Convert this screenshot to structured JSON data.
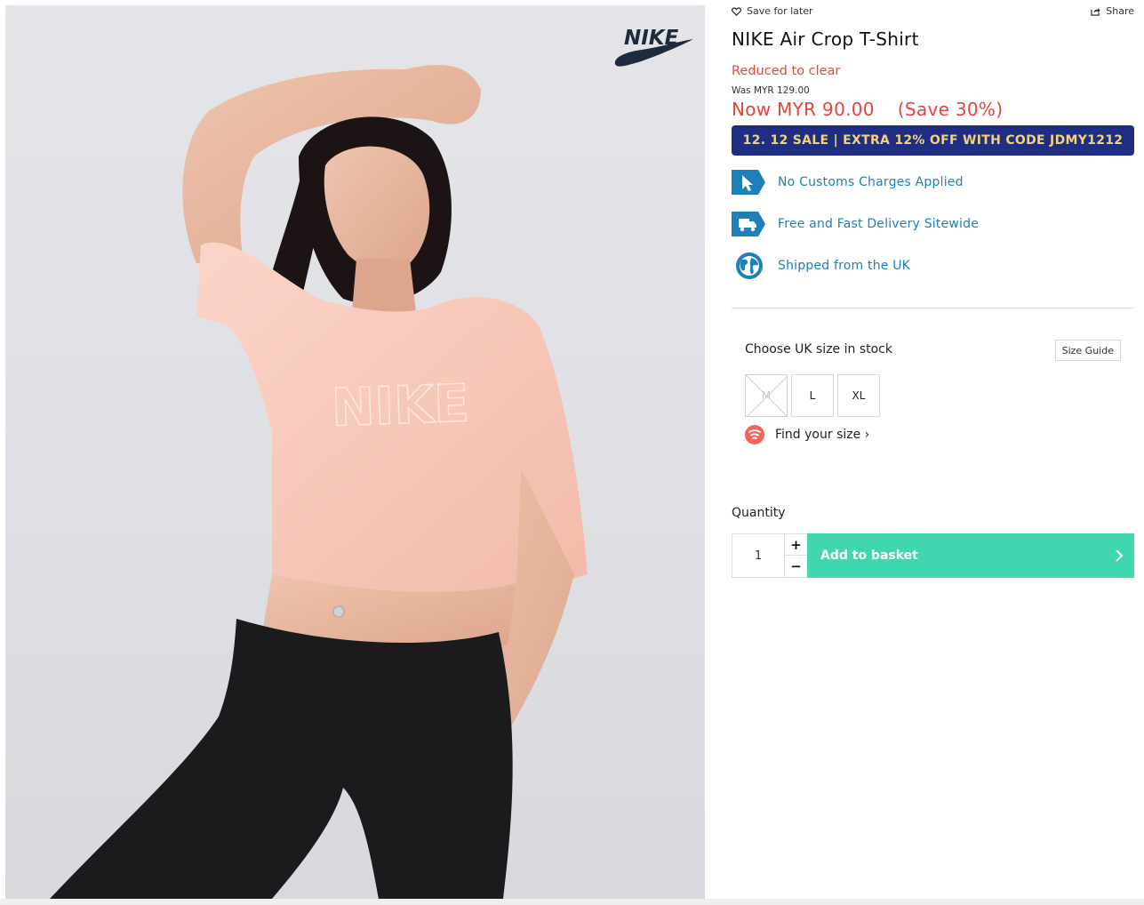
{
  "top_links": {
    "save_for_later": "Save for later",
    "share": "Share"
  },
  "product": {
    "brand_logo_text": "NIKE",
    "title": "NIKE Air Crop T-Shirt",
    "reduced_label": "Reduced to clear",
    "was_price": "Was MYR 129.00",
    "now_price": "Now MYR 90.00",
    "save_text": "(Save 30%)",
    "shirt_print_text": "NIKE"
  },
  "promo_banner": "12. 12 SALE | EXTRA 12% OFF WITH CODE JDMY1212",
  "features": [
    {
      "icon": "cursor-icon",
      "label": "No Customs Charges Applied"
    },
    {
      "icon": "truck-icon",
      "label": "Free and Fast Delivery Sitewide"
    },
    {
      "icon": "globe-icon",
      "label": "Shipped from the UK"
    }
  ],
  "size_selector": {
    "label": "Choose UK size in stock",
    "guide_label": "Size Guide",
    "sizes": [
      {
        "label": "M",
        "in_stock": false
      },
      {
        "label": "L",
        "in_stock": true
      },
      {
        "label": "XL",
        "in_stock": true
      }
    ],
    "find_size": "Find your size ›"
  },
  "quantity": {
    "label": "Quantity",
    "value": "1",
    "plus": "+",
    "minus": "−"
  },
  "add_to_basket": "Add to basket",
  "colors": {
    "sale_red": "#e8443a",
    "promo_bg": "#1f2d83",
    "promo_text": "#f4d27a",
    "feature_blue": "#1f7fb8",
    "basket_green": "#3fd6b0",
    "shirt_pink": "#f8c9bc"
  }
}
